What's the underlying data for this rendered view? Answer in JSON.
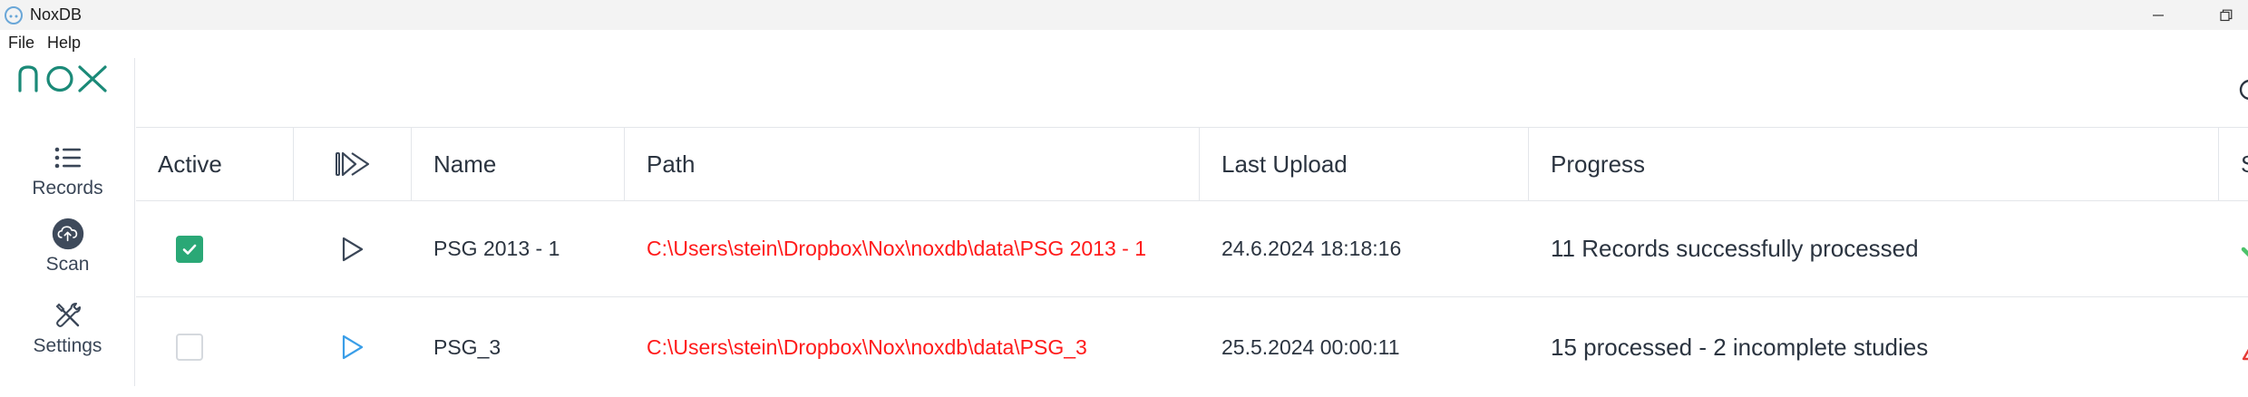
{
  "window": {
    "title": "NoxDB"
  },
  "menu": {
    "file": "File",
    "help": "Help"
  },
  "sidebar": {
    "logo_text": "nox",
    "items": [
      {
        "label": "Records",
        "icon": "list-icon"
      },
      {
        "label": "Scan",
        "icon": "cloud-upload-icon"
      },
      {
        "label": "Settings",
        "icon": "tools-icon"
      }
    ]
  },
  "table": {
    "headers": {
      "active": "Active",
      "play": "play-all-icon",
      "name": "Name",
      "path": "Path",
      "last_upload": "Last Upload",
      "progress": "Progress",
      "status": "Stat"
    },
    "rows": [
      {
        "active": true,
        "name": "PSG 2013 - 1",
        "path": "C:\\Users\\stein\\Dropbox\\Nox\\noxdb\\data\\PSG 2013 - 1",
        "last_upload": "24.6.2024 18:18:16",
        "progress": "11 Records successfully processed",
        "status_icon": "checkmark-icon"
      },
      {
        "active": false,
        "name": "PSG_3",
        "path": "C:\\Users\\stein\\Dropbox\\Nox\\noxdb\\data\\PSG_3",
        "last_upload": "25.5.2024 00:00:11",
        "progress": "15 processed - 2 incomplete studies",
        "status_icon": "warning-icon"
      }
    ]
  },
  "colors": {
    "brand": "#1b8a78",
    "checkbox_checked": "#2aa876",
    "path_text": "#ff1a1a",
    "play_active": "#3a9ee8",
    "status_ok": "#4cc26a",
    "status_warning": "#e53935"
  }
}
